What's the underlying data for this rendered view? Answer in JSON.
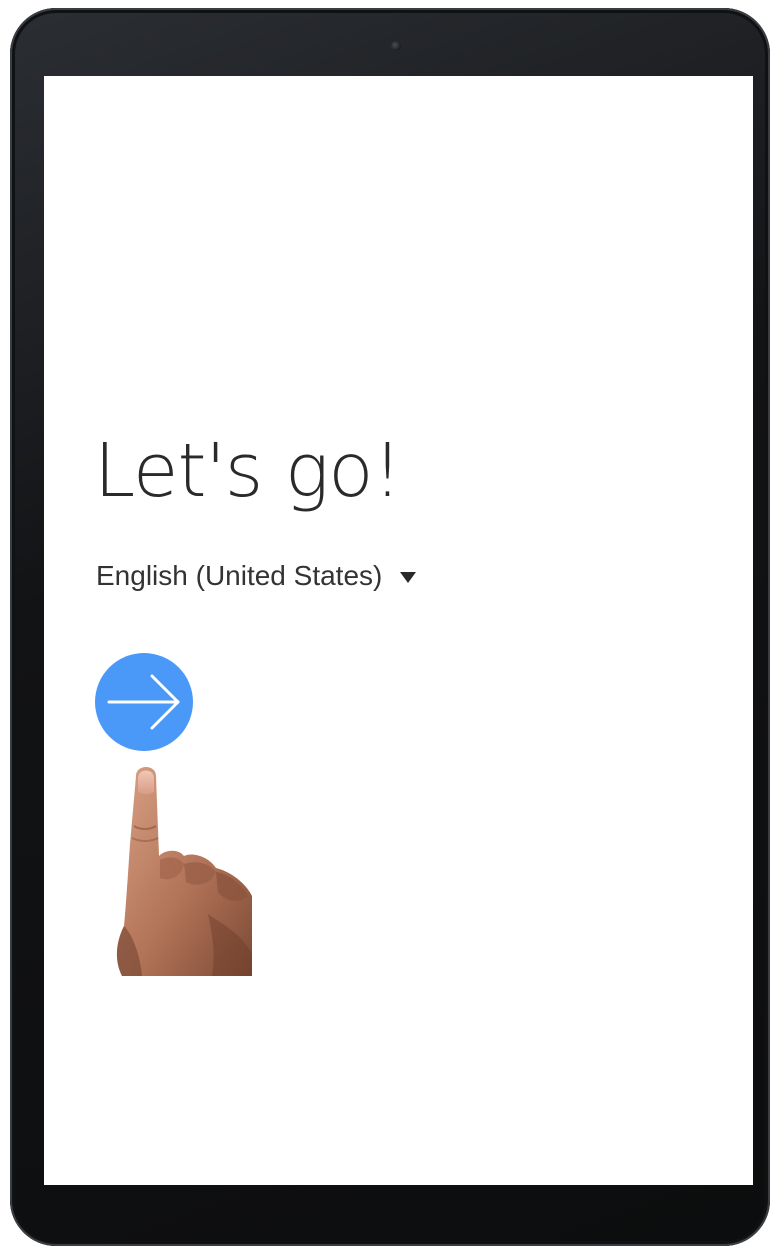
{
  "screen": {
    "title": "Let's go!",
    "language": {
      "selected": "English (United States)",
      "icon": "dropdown-triangle-icon"
    },
    "next_button": {
      "icon": "arrow-right-icon",
      "color": "#4a98f7"
    }
  },
  "colors": {
    "bezel": "#121315",
    "screen_background": "#ffffff",
    "text": "#2a2a2a",
    "accent": "#4a98f7"
  }
}
